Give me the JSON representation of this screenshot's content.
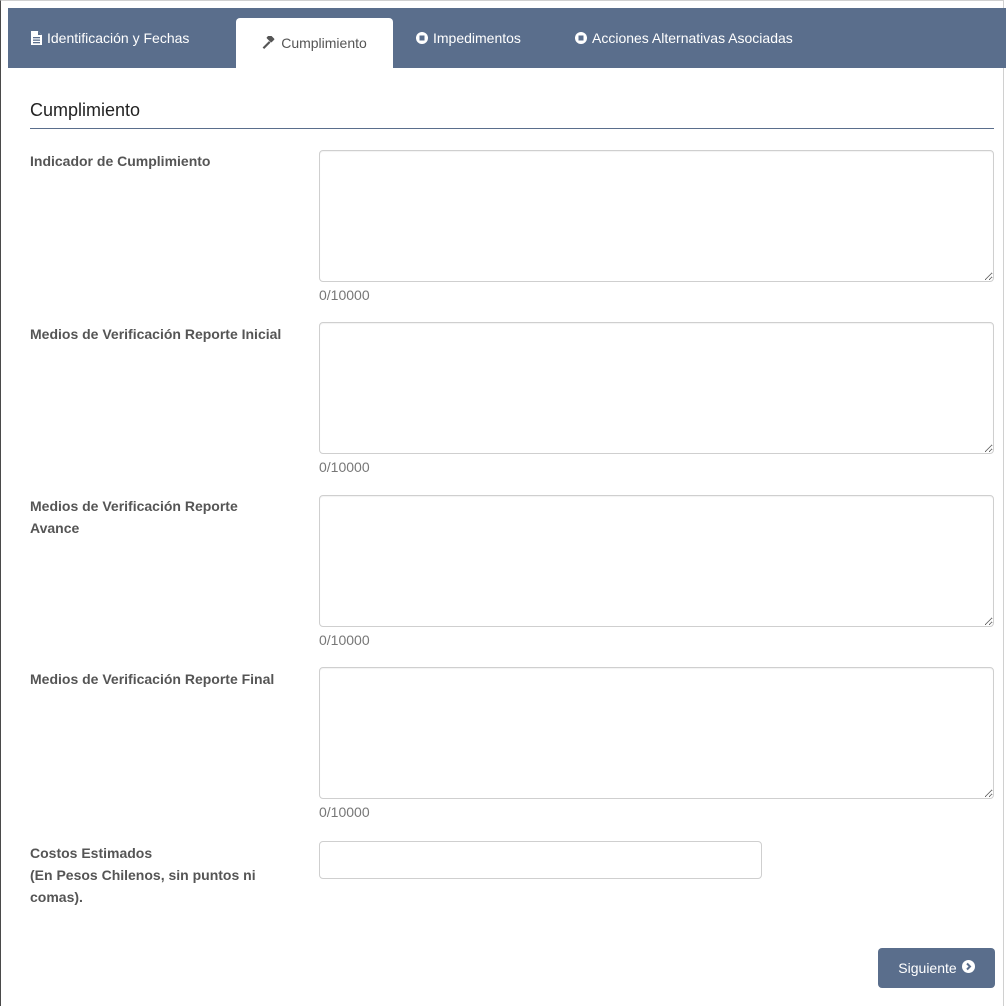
{
  "tabs": [
    {
      "label": "Identificación y Fechas",
      "icon": "document-icon",
      "active": false
    },
    {
      "label": "Cumplimiento",
      "icon": "gavel-icon",
      "active": true
    },
    {
      "label": "Impedimentos",
      "icon": "stop-circle-icon",
      "active": false
    },
    {
      "label": "Acciones Alternativas Asociadas",
      "icon": "stop-circle-icon",
      "active": false
    }
  ],
  "section": {
    "title": "Cumplimiento"
  },
  "fields": [
    {
      "label": "Indicador de Cumplimiento",
      "counter": "0/10000",
      "value": ""
    },
    {
      "label": "Medios de Verificación Reporte Inicial",
      "counter": "0/10000",
      "value": ""
    },
    {
      "label": "Medios de Verificación Reporte Avance",
      "counter": "0/10000",
      "value": ""
    },
    {
      "label": "Medios de Verificación Reporte Final",
      "counter": "0/10000",
      "value": ""
    }
  ],
  "cost": {
    "label_line1": "Costos Estimados",
    "label_line2": "(En Pesos Chilenos, sin puntos ni comas).",
    "value": ""
  },
  "next_button": {
    "label": "Siguiente",
    "icon": "chevron-circle-right-icon"
  },
  "colors": {
    "accent": "#5a6e8c",
    "tab_text": "#ffffff",
    "label": "#555555"
  }
}
